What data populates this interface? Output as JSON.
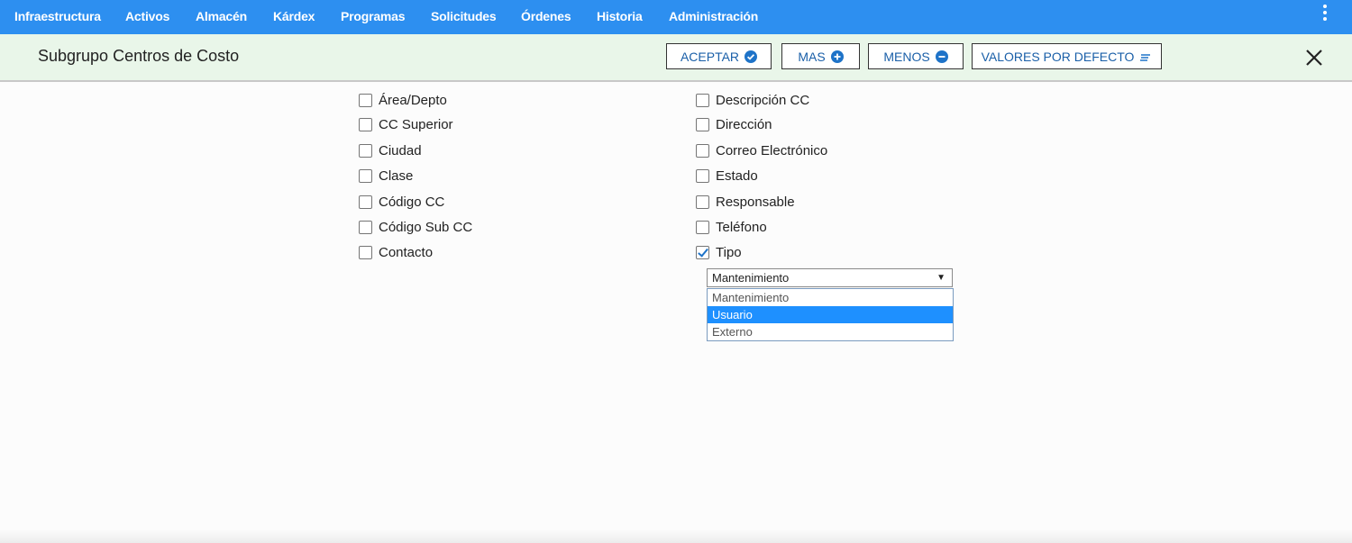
{
  "nav": {
    "items": [
      "Infraestructura",
      "Activos",
      "Almacén",
      "Kárdex",
      "Programas",
      "Solicitudes",
      "Órdenes",
      "Historia",
      "Administración"
    ]
  },
  "header": {
    "title": "Subgrupo Centros de Costo",
    "buttons": {
      "accept": "ACEPTAR",
      "more": "MAS",
      "less": "MENOS",
      "defaults": "VALORES POR DEFECTO"
    }
  },
  "fields": {
    "left": [
      {
        "label": "Área/Depto",
        "checked": false
      },
      {
        "label": "CC Superior",
        "checked": false
      },
      {
        "label": "Ciudad",
        "checked": false
      },
      {
        "label": "Clase",
        "checked": false
      },
      {
        "label": "Código CC",
        "checked": false
      },
      {
        "label": "Código Sub CC",
        "checked": false
      },
      {
        "label": "Contacto",
        "checked": false
      }
    ],
    "right": [
      {
        "label": "Descripción CC",
        "checked": false
      },
      {
        "label": "Dirección",
        "checked": false
      },
      {
        "label": "Correo Electrónico",
        "checked": false
      },
      {
        "label": "Estado",
        "checked": false
      },
      {
        "label": "Responsable",
        "checked": false
      },
      {
        "label": "Teléfono",
        "checked": false
      },
      {
        "label": "Tipo",
        "checked": true
      }
    ]
  },
  "tipo_select": {
    "value": "Mantenimiento",
    "options": [
      "Mantenimiento",
      "Usuario",
      "Externo"
    ],
    "highlighted": "Usuario"
  },
  "colors": {
    "nav_bg": "#2d8ff0",
    "header_bg": "#e9f6e9",
    "accent": "#1e73c8",
    "highlight": "#1e90ff"
  }
}
